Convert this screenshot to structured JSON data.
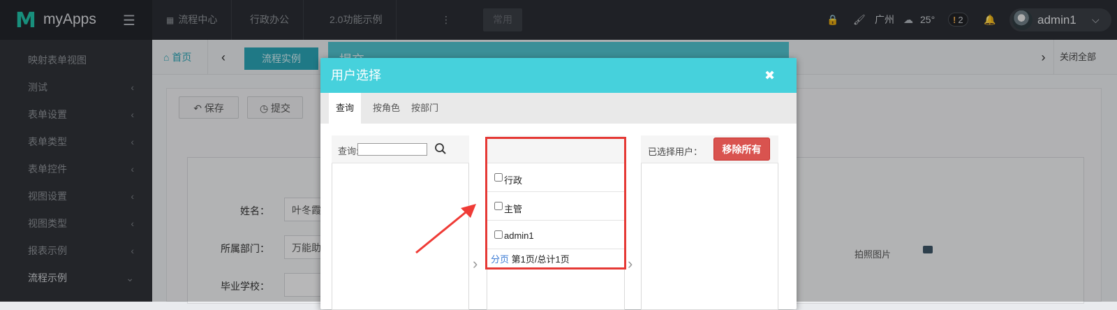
{
  "header": {
    "app_name": "myApps",
    "nav": [
      "流程中心",
      "行政办公",
      "2.0功能示例"
    ],
    "more": "⋮",
    "common_button": "常用",
    "city": "广州",
    "temperature": "25°",
    "badge_count": "2",
    "username": "admin1"
  },
  "sidebar": {
    "items": [
      {
        "label": "映射表单视图",
        "chevron": ""
      },
      {
        "label": "测试",
        "chevron": "‹"
      },
      {
        "label": "表单设置",
        "chevron": "‹"
      },
      {
        "label": "表单类型",
        "chevron": "‹"
      },
      {
        "label": "表单控件",
        "chevron": "‹"
      },
      {
        "label": "视图设置",
        "chevron": "‹"
      },
      {
        "label": "视图类型",
        "chevron": "‹"
      },
      {
        "label": "报表示例",
        "chevron": "‹"
      },
      {
        "label": "流程示例",
        "chevron": "⌄"
      }
    ]
  },
  "tabs": {
    "home": "首页",
    "flow_instance": "流程实例",
    "close_all": "关闭全部"
  },
  "background_form": {
    "save": "保存",
    "submit": "提交",
    "name_label": "姓名：",
    "name_value": "叶冬霞",
    "dept_label": "所属部门：",
    "dept_value": "万能助",
    "school_label": "毕业学校：",
    "photo_text": "拍照图片"
  },
  "back_dialog": {
    "title": "提交"
  },
  "modal": {
    "title": "用户选择",
    "close": "✖",
    "tabs": [
      "查询",
      "按角色",
      "按部门"
    ],
    "search_label": "查询:",
    "search_value": "",
    "role_items": [
      "行政",
      "主管",
      "admin1"
    ],
    "pager_link": "分页",
    "pager_text": "第1页/总计1页",
    "selected_label": "已选择用户：",
    "remove_all": "移除所有"
  },
  "colors": {
    "accent": "#46d1dc",
    "danger": "#d9534f",
    "highlight_box": "#e53935"
  }
}
